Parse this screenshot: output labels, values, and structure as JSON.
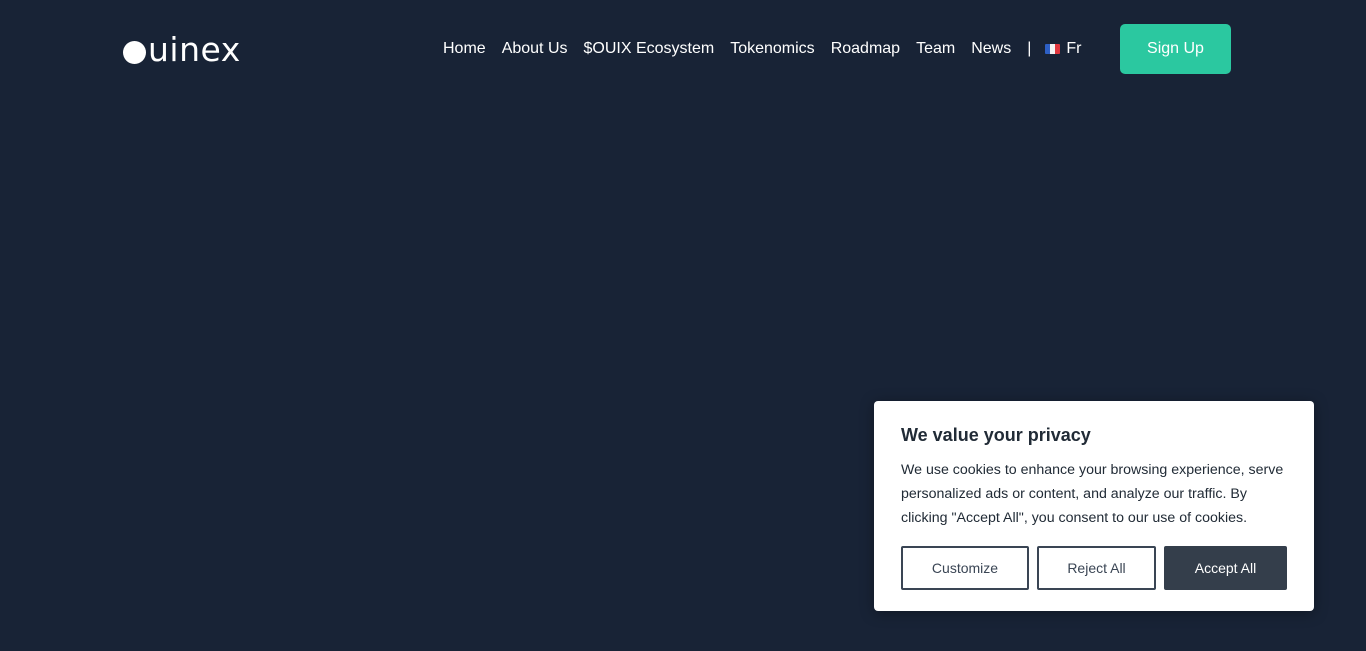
{
  "header": {
    "logo_text": "uinex",
    "nav": [
      {
        "label": "Home"
      },
      {
        "label": "About Us"
      },
      {
        "label": "$OUIX Ecosystem"
      },
      {
        "label": "Tokenomics"
      },
      {
        "label": "Roadmap"
      },
      {
        "label": "Team"
      },
      {
        "label": "News"
      }
    ],
    "separator": "|",
    "language": {
      "flag_icon": "france-flag-icon",
      "label": "Fr"
    },
    "signup_label": "Sign Up"
  },
  "cookie_banner": {
    "title": "We value your privacy",
    "text": "We use cookies to enhance your browsing experience, serve personalized ads or content, and analyze our traffic. By clicking \"Accept All\", you consent to our use of cookies.",
    "buttons": {
      "customize": "Customize",
      "reject": "Reject All",
      "accept": "Accept All"
    }
  },
  "colors": {
    "background": "#182336",
    "accent": "#2bc8a0",
    "button_dark": "#343e4b",
    "text_dark": "#212b36"
  }
}
